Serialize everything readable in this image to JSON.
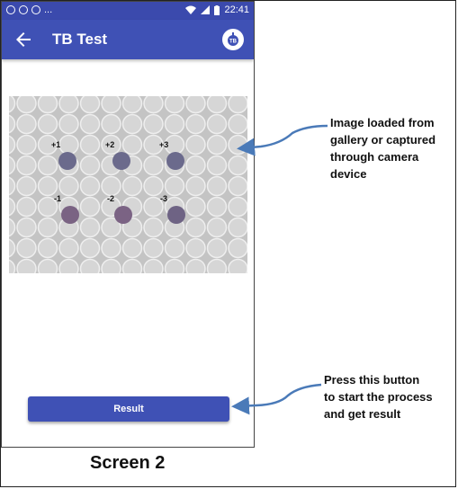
{
  "statusbar": {
    "left_dots": "...",
    "time": "22:41"
  },
  "app": {
    "title": "TB Test",
    "logo_text": "TB"
  },
  "plate": {
    "labels": [
      "+1",
      "+2",
      "+3",
      "-1",
      "-2",
      "-3"
    ]
  },
  "main": {
    "result_button_label": "Result"
  },
  "annotations": {
    "image_note": "Image loaded from\ngallery or captured\nthrough camera\ndevice",
    "button_note": "Press this button\nto start the process\nand get result"
  },
  "caption": "Screen 2",
  "colors": {
    "appbar": "#3f51b5",
    "statusbar": "#3b4aad",
    "arrow": "#4a7ab8"
  }
}
